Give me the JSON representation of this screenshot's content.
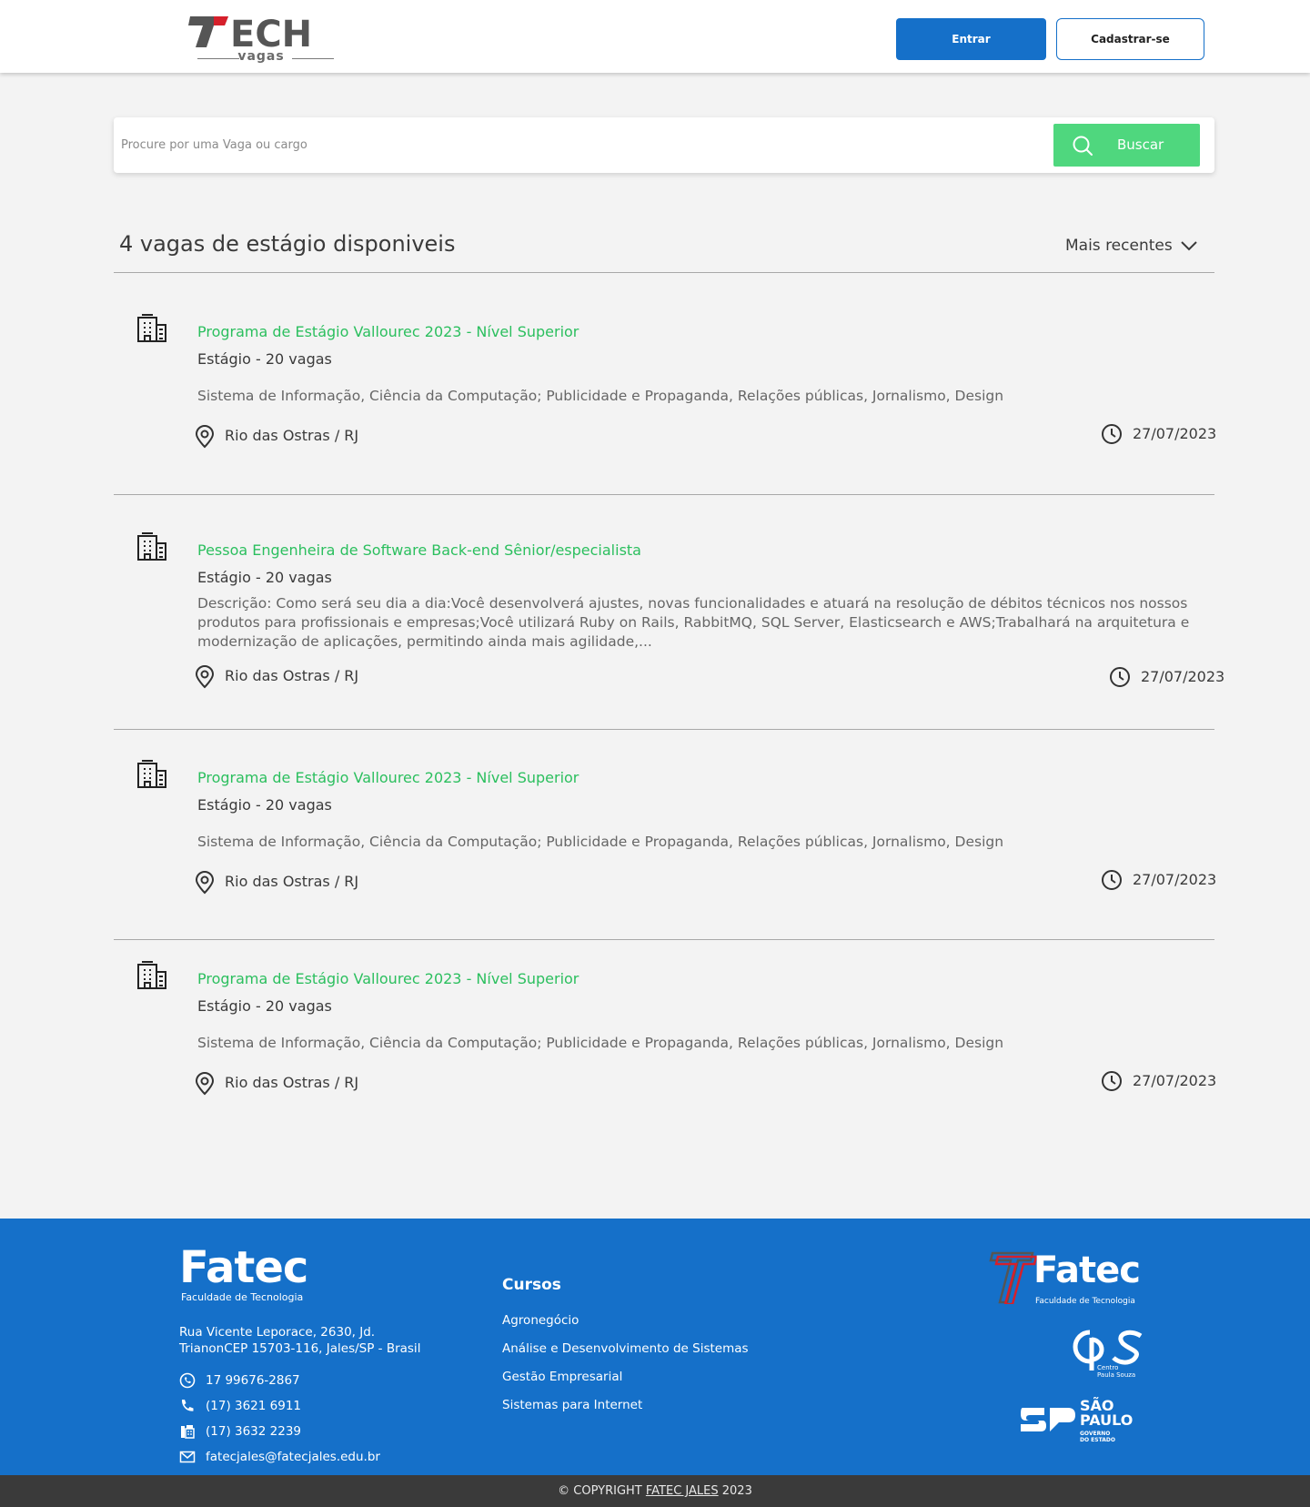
{
  "header": {
    "logo_text": "TECH",
    "logo_subtext": "vagas",
    "login_label": "Entrar",
    "register_label": "Cadastrar-se",
    "colors": {
      "primary": "#1570c9",
      "logo_red": "#d6202b",
      "logo_gray": "#555555"
    }
  },
  "search": {
    "placeholder": "Procure por uma Vaga ou cargo",
    "value": "",
    "button_label": "Buscar",
    "button_color": "#4fd77e",
    "icon": "search-icon"
  },
  "results": {
    "title": "4 vagas de estágio disponiveis",
    "sort_label": "Mais recentes",
    "sort_icon": "chevron-down-icon"
  },
  "jobs": [
    {
      "title": "Programa de Estágio Vallourec 2023 - Nível Superior",
      "meta": "Estágio - 20 vagas",
      "description": "Sistema de Informação, Ciência da Computação; Publicidade e Propaganda, Relações públicas, Jornalismo, Design",
      "location": "Rio das Ostras / RJ",
      "date": "27/07/2023"
    },
    {
      "title": "Pessoa Engenheira de Software Back-end Sênior/especialista",
      "meta": "Estágio - 20 vagas",
      "description": "Descrição: Como será seu dia a dia:Você desenvolverá ajustes, novas funcionalidades e atuará na resolução de débitos técnicos nos nossos produtos para profissionais e empresas;Você utilizará Ruby on Rails, RabbitMQ, SQL Server, Elasticsearch e AWS;Trabalhará na arquitetura e modernização de aplicações, permitindo ainda mais agilidade,...",
      "location": "Rio das Ostras / RJ",
      "date": "27/07/2023"
    },
    {
      "title": "Programa de Estágio Vallourec 2023 - Nível Superior",
      "meta": "Estágio - 20 vagas",
      "description": "Sistema de Informação, Ciência da Computação; Publicidade e Propaganda, Relações públicas, Jornalismo, Design",
      "location": "Rio das Ostras / RJ",
      "date": "27/07/2023"
    },
    {
      "title": "Programa de Estágio Vallourec 2023 - Nível Superior",
      "meta": "Estágio - 20 vagas",
      "description": "Sistema de Informação, Ciência da Computação; Publicidade e Propaganda, Relações públicas, Jornalismo, Design",
      "location": "Rio das Ostras / RJ",
      "date": "27/07/2023"
    }
  ],
  "footer": {
    "brand": "Fatec",
    "brand_tagline": "Faculdade de Tecnologia",
    "address": "Rua Vicente Leporace, 2630, Jd. TrianonCEP 15703-116, Jales/SP - Brasil",
    "contacts": [
      {
        "icon": "whatsapp-icon",
        "text": "17 99676-2867"
      },
      {
        "icon": "phone-icon",
        "text": "(17) 3621 6911"
      },
      {
        "icon": "fax-icon",
        "text": "(17) 3632 2239"
      },
      {
        "icon": "mail-icon",
        "text": "fatecjales@fatecjales.edu.br"
      }
    ],
    "courses_title": "Cursos",
    "courses": [
      "Agronegócio",
      "Análise e Desenvolvimento de Sistemas",
      "Gestão Empresarial",
      "Sistemas para Internet"
    ],
    "partners": {
      "fatec_word": "Fatec",
      "fatec_tagline": "Faculdade de Tecnologia",
      "cps_tagline_1": "Centro",
      "cps_tagline_2": "Paula Souza",
      "sp_line_1": "SÃO",
      "sp_line_2": "PAULO",
      "sp_small_1": "GOVERNO",
      "sp_small_2": "DO ESTADO"
    },
    "background": "#1570c9"
  },
  "copyright": {
    "prefix": "© COPYRIGHT ",
    "link": "FATEC JALES",
    "suffix": " 2023"
  }
}
